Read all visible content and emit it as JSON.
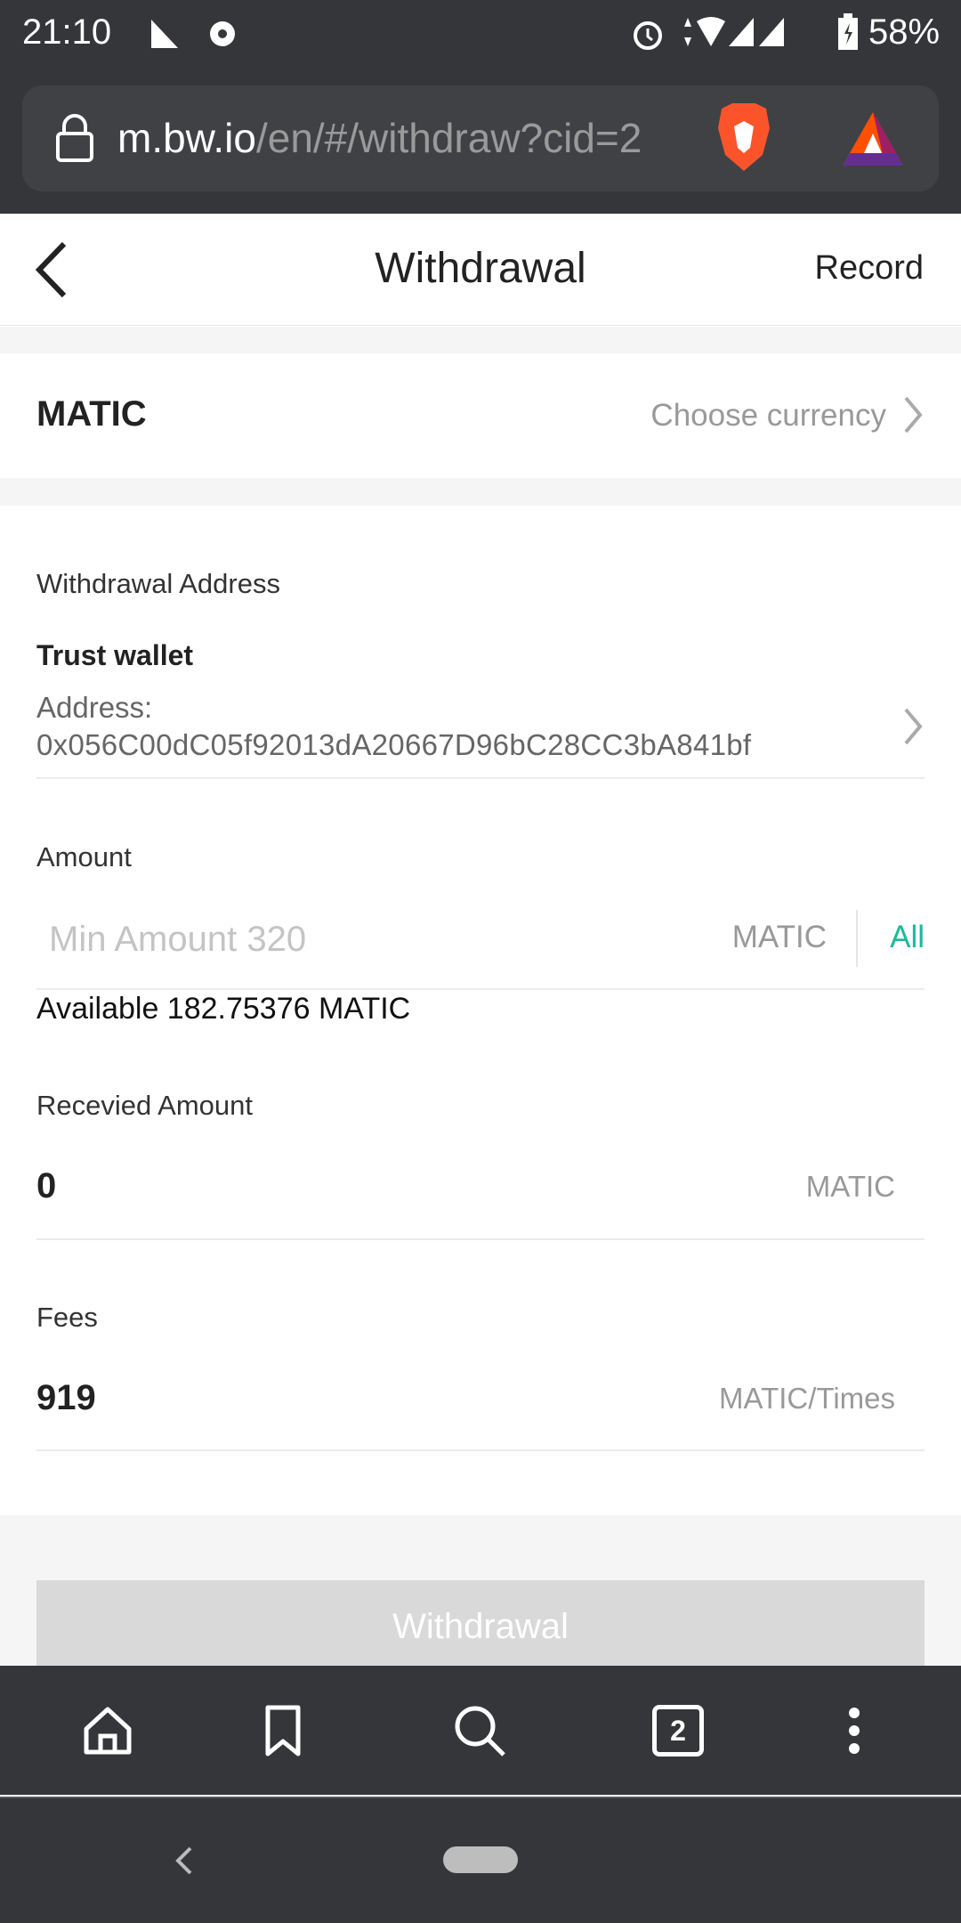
{
  "status_bar": {
    "time": "21:10",
    "battery": "58%"
  },
  "browser": {
    "url_host": "m.bw.io",
    "url_path": "/en/#/withdraw?cid=2",
    "tab_count": "2"
  },
  "header": {
    "title": "Withdrawal",
    "record": "Record"
  },
  "currency": {
    "selected": "MATIC",
    "choose": "Choose currency"
  },
  "address": {
    "label": "Withdrawal Address",
    "wallet_name": "Trust wallet",
    "address_label": "Address:",
    "address_value": "0x056C00dC05f92013dA20667D96bC28CC3bA841bf"
  },
  "amount": {
    "label": "Amount",
    "placeholder": "Min Amount 320",
    "unit": "MATIC",
    "all": "All",
    "available": "Available 182.75376 MATIC"
  },
  "received": {
    "label": "Recevied Amount",
    "value": "0",
    "unit": "MATIC"
  },
  "fees": {
    "label": "Fees",
    "value": "919",
    "unit": "MATIC/Times"
  },
  "submit": {
    "label": "Withdrawal"
  },
  "colors": {
    "accent": "#1bb99a",
    "chrome": "#35363a",
    "button_disabled": "#d9d9d9"
  }
}
